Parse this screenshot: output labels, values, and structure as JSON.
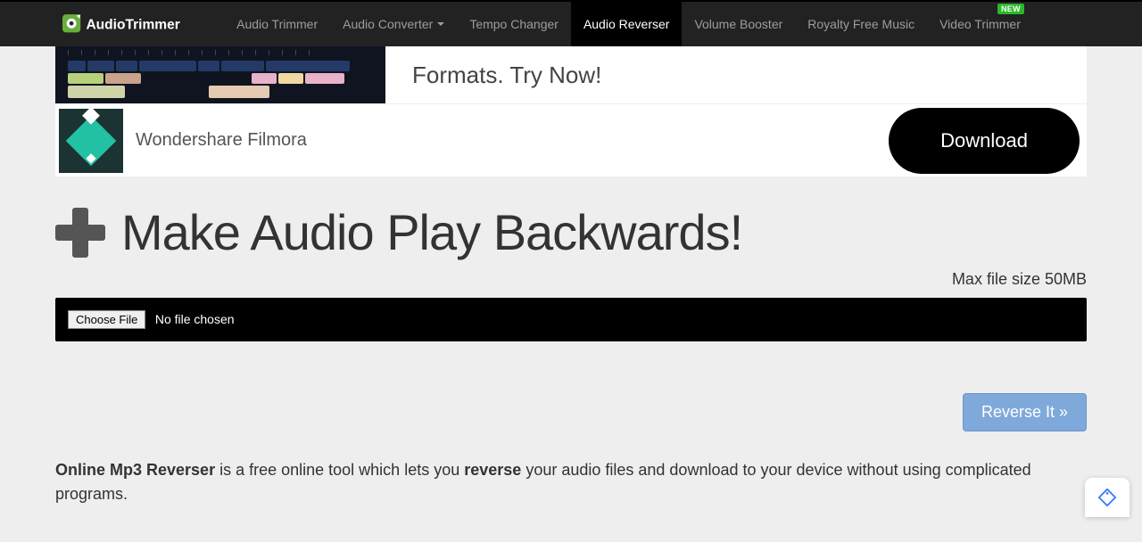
{
  "brand": "AudioTrimmer",
  "nav": {
    "items": [
      {
        "label": "Audio Trimmer",
        "active": false,
        "dropdown": false,
        "new": false
      },
      {
        "label": "Audio Converter",
        "active": false,
        "dropdown": true,
        "new": false
      },
      {
        "label": "Tempo Changer",
        "active": false,
        "dropdown": false,
        "new": false
      },
      {
        "label": "Audio Reverser",
        "active": true,
        "dropdown": false,
        "new": false
      },
      {
        "label": "Volume Booster",
        "active": false,
        "dropdown": false,
        "new": false
      },
      {
        "label": "Royalty Free Music",
        "active": false,
        "dropdown": false,
        "new": false
      },
      {
        "label": "Video Trimmer",
        "active": false,
        "dropdown": false,
        "new": true,
        "badge": "NEW"
      }
    ]
  },
  "ad": {
    "top_text": "Formats. Try Now!",
    "product": "Wondershare Filmora",
    "cta": "Download"
  },
  "page": {
    "title": "Make Audio Play Backwards!",
    "max_size": "Max file size 50MB",
    "choose_btn": "Choose File",
    "file_status": "No file chosen",
    "action_btn": "Reverse It »"
  },
  "desc": {
    "bold1": "Online Mp3 Reverser",
    "mid1": " is a free online tool which lets you ",
    "bold2": "reverse",
    "mid2": " your audio files and download to your device without using complicated programs."
  }
}
